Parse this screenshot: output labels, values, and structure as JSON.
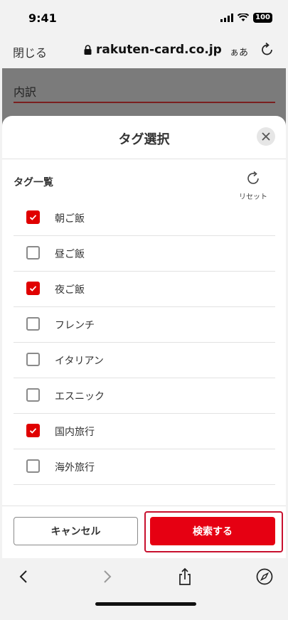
{
  "status": {
    "time": "9:41",
    "battery": "100"
  },
  "browser": {
    "close_label": "閉じる",
    "url": "rakuten-card.co.jp",
    "text_size_label": "ぁあ"
  },
  "background_page": {
    "field_label": "内訳"
  },
  "sheet": {
    "title": "タグ選択",
    "list_title": "タグ一覧",
    "reset_label": "リセット",
    "tags": [
      {
        "label": "朝ご飯",
        "checked": true
      },
      {
        "label": "昼ご飯",
        "checked": false
      },
      {
        "label": "夜ご飯",
        "checked": true
      },
      {
        "label": "フレンチ",
        "checked": false
      },
      {
        "label": "イタリアン",
        "checked": false
      },
      {
        "label": "エスニック",
        "checked": false
      },
      {
        "label": "国内旅行",
        "checked": true
      },
      {
        "label": "海外旅行",
        "checked": false
      }
    ],
    "cancel_label": "キャンセル",
    "search_label": "検索する"
  },
  "colors": {
    "accent": "#e60012",
    "overlay": "#7b7b7b"
  },
  "icons": [
    "lock-icon",
    "reload-icon",
    "close-icon",
    "reset-icon",
    "checkmark-icon",
    "back-icon",
    "forward-icon",
    "share-icon",
    "compass-icon"
  ]
}
